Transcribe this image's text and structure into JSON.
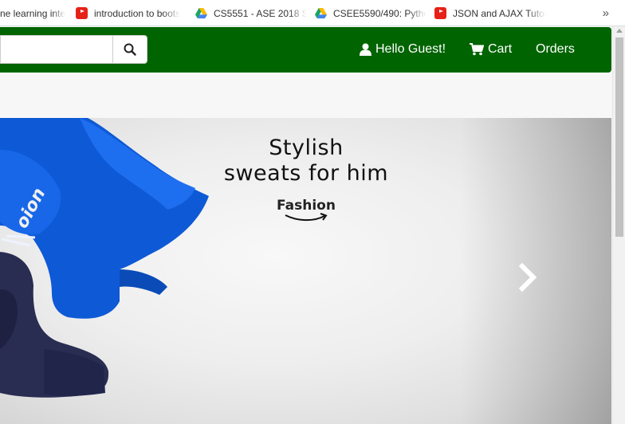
{
  "browser": {
    "bookmarks": [
      {
        "label": "ne learning inte",
        "icon": "none"
      },
      {
        "label": "introduction to boots",
        "icon": "youtube-icon"
      },
      {
        "label": "CS5551 - ASE 2018 S",
        "icon": "google-drive-icon"
      },
      {
        "label": "CSEE5590/490: Pytho",
        "icon": "google-drive-icon"
      },
      {
        "label": "JSON and AJAX Tutor",
        "icon": "youtube-icon"
      }
    ],
    "overflow_label": "»"
  },
  "navbar": {
    "search_placeholder": "",
    "search_value": "",
    "user_label": "Hello Guest!",
    "cart_label": "Cart",
    "orders_label": "Orders",
    "background": "#006400"
  },
  "carousel": {
    "headline_line1": "Stylish",
    "headline_line2": "sweats for him",
    "category": "Fashion",
    "next_control": "chevron-right-icon"
  }
}
